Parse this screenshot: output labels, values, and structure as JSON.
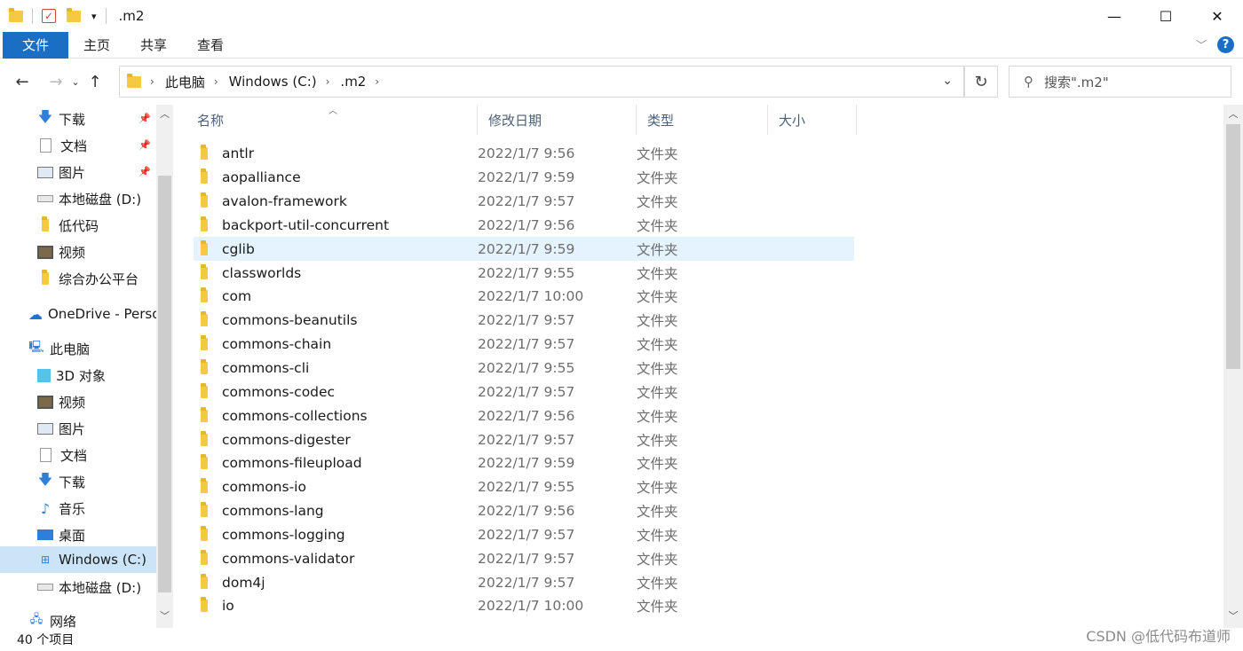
{
  "window": {
    "title": ".m2",
    "controls": {
      "minimize": "—",
      "maximize": "☐",
      "close": "✕"
    }
  },
  "ribbon": {
    "tabs": [
      {
        "label": "文件",
        "active": true
      },
      {
        "label": "主页"
      },
      {
        "label": "共享"
      },
      {
        "label": "查看"
      }
    ],
    "help_label": "?"
  },
  "address": {
    "crumbs": [
      "此电脑",
      "Windows (C:)",
      ".m2"
    ],
    "search_placeholder": "搜索\".m2\""
  },
  "sidebar": {
    "items": [
      {
        "label": "下载",
        "icon": "download-arrow-icon",
        "pinned": true
      },
      {
        "label": "文档",
        "icon": "document-icon",
        "pinned": true
      },
      {
        "label": "图片",
        "icon": "picture-icon",
        "pinned": true
      },
      {
        "label": "本地磁盘 (D:)",
        "icon": "drive-icon"
      },
      {
        "label": "低代码",
        "icon": "folder-icon"
      },
      {
        "label": "视频",
        "icon": "video-icon"
      },
      {
        "label": "综合办公平台",
        "icon": "folder-icon"
      },
      {
        "label": "OneDrive - Personal",
        "icon": "cloud-icon"
      },
      {
        "label": "此电脑",
        "icon": "computer-icon"
      },
      {
        "label": "3D 对象",
        "icon": "cube-icon"
      },
      {
        "label": "视频",
        "icon": "video-icon"
      },
      {
        "label": "图片",
        "icon": "picture-icon"
      },
      {
        "label": "文档",
        "icon": "document-icon"
      },
      {
        "label": "下载",
        "icon": "download-arrow-icon"
      },
      {
        "label": "音乐",
        "icon": "music-note-icon"
      },
      {
        "label": "桌面",
        "icon": "desktop-icon"
      },
      {
        "label": "Windows (C:)",
        "icon": "windows-drive-icon",
        "selected": true
      },
      {
        "label": "本地磁盘 (D:)",
        "icon": "drive-icon"
      },
      {
        "label": "网络",
        "icon": "network-icon"
      }
    ]
  },
  "columns": {
    "name": "名称",
    "date": "修改日期",
    "type": "类型",
    "size": "大小"
  },
  "files": [
    {
      "name": "antlr",
      "date": "2022/1/7 9:56",
      "type": "文件夹"
    },
    {
      "name": "aopalliance",
      "date": "2022/1/7 9:59",
      "type": "文件夹"
    },
    {
      "name": "avalon-framework",
      "date": "2022/1/7 9:57",
      "type": "文件夹"
    },
    {
      "name": "backport-util-concurrent",
      "date": "2022/1/7 9:56",
      "type": "文件夹"
    },
    {
      "name": "cglib",
      "date": "2022/1/7 9:59",
      "type": "文件夹",
      "selected": true
    },
    {
      "name": "classworlds",
      "date": "2022/1/7 9:55",
      "type": "文件夹"
    },
    {
      "name": "com",
      "date": "2022/1/7 10:00",
      "type": "文件夹"
    },
    {
      "name": "commons-beanutils",
      "date": "2022/1/7 9:57",
      "type": "文件夹"
    },
    {
      "name": "commons-chain",
      "date": "2022/1/7 9:57",
      "type": "文件夹"
    },
    {
      "name": "commons-cli",
      "date": "2022/1/7 9:55",
      "type": "文件夹"
    },
    {
      "name": "commons-codec",
      "date": "2022/1/7 9:57",
      "type": "文件夹"
    },
    {
      "name": "commons-collections",
      "date": "2022/1/7 9:56",
      "type": "文件夹"
    },
    {
      "name": "commons-digester",
      "date": "2022/1/7 9:57",
      "type": "文件夹"
    },
    {
      "name": "commons-fileupload",
      "date": "2022/1/7 9:59",
      "type": "文件夹"
    },
    {
      "name": "commons-io",
      "date": "2022/1/7 9:55",
      "type": "文件夹"
    },
    {
      "name": "commons-lang",
      "date": "2022/1/7 9:56",
      "type": "文件夹"
    },
    {
      "name": "commons-logging",
      "date": "2022/1/7 9:57",
      "type": "文件夹"
    },
    {
      "name": "commons-validator",
      "date": "2022/1/7 9:57",
      "type": "文件夹"
    },
    {
      "name": "dom4j",
      "date": "2022/1/7 9:57",
      "type": "文件夹"
    },
    {
      "name": "io",
      "date": "2022/1/7 10:00",
      "type": "文件夹"
    }
  ],
  "status": {
    "item_count": "40 个项目"
  },
  "watermark": "CSDN @低代码布道师"
}
